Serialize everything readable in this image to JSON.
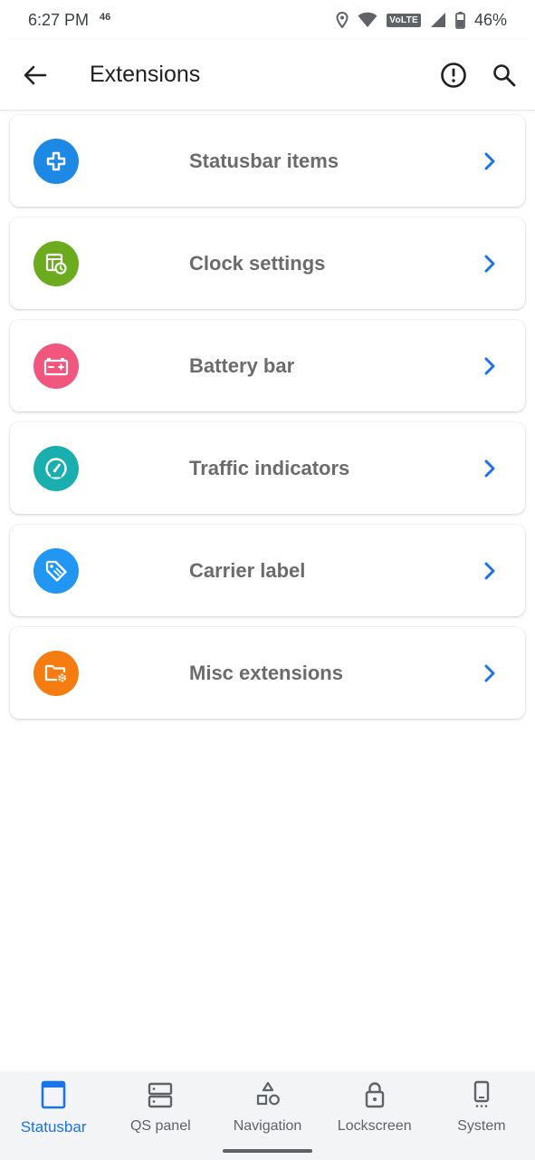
{
  "status_bar": {
    "time": "6:27 PM",
    "network_type": "46",
    "volte_label": "VoLTE",
    "battery_percent": "46%"
  },
  "app_bar": {
    "title": "Extensions"
  },
  "items": [
    {
      "label": "Statusbar items",
      "icon": "plus-box-icon",
      "color": "#1e88e5"
    },
    {
      "label": "Clock settings",
      "icon": "calendar-clock-icon",
      "color": "#6bab1e"
    },
    {
      "label": "Battery bar",
      "icon": "battery-charge-icon",
      "color": "#f0567e"
    },
    {
      "label": "Traffic indicators",
      "icon": "speedometer-icon",
      "color": "#1aaeae"
    },
    {
      "label": "Carrier label",
      "icon": "tag-icon",
      "color": "#2196f3"
    },
    {
      "label": "Misc extensions",
      "icon": "folder-settings-icon",
      "color": "#f57c10"
    }
  ],
  "bottom_nav": {
    "items": [
      {
        "label": "Statusbar",
        "icon": "statusbar-icon",
        "active": true
      },
      {
        "label": "QS panel",
        "icon": "qs-panel-icon",
        "active": false
      },
      {
        "label": "Navigation",
        "icon": "shapes-icon",
        "active": false
      },
      {
        "label": "Lockscreen",
        "icon": "lock-icon",
        "active": false
      },
      {
        "label": "System",
        "icon": "phone-icon",
        "active": false
      }
    ]
  },
  "colors": {
    "accent": "#1a73e8",
    "chevron": "#1a73e8"
  }
}
